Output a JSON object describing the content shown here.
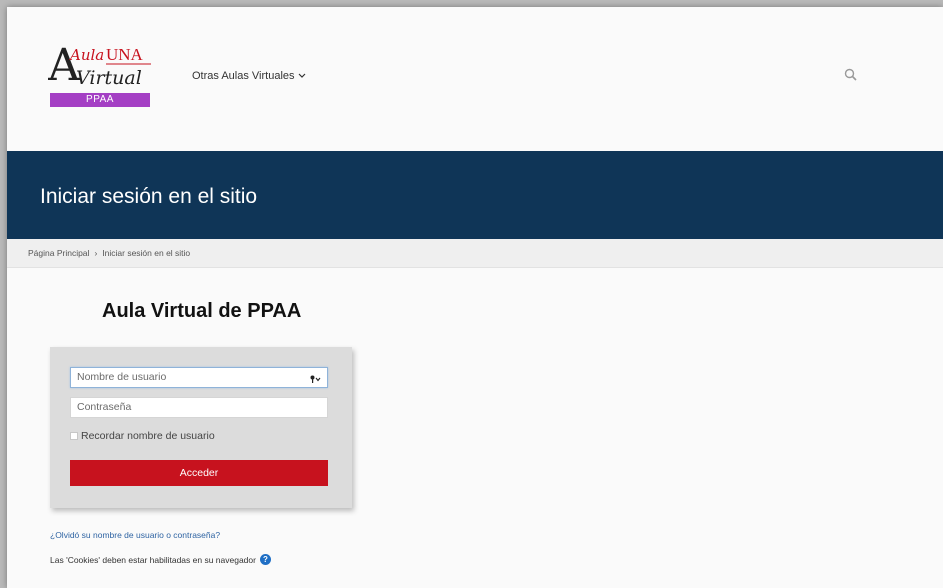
{
  "logo": {
    "word_aula": "Aula",
    "word_una": "UNA",
    "word_virtual": "Virtual",
    "badge": "PPAA"
  },
  "nav": {
    "menu_label": "Otras Aulas Virtuales",
    "search_icon": "search-icon",
    "chevron_icon": "chevron-down-icon"
  },
  "banner": {
    "title": "Iniciar sesión en el sitio"
  },
  "breadcrumb": {
    "items": [
      "Página Principal",
      "Iniciar sesión en el sitio"
    ],
    "separator": "›"
  },
  "login": {
    "site_title": "Aula Virtual de PPAA",
    "username_placeholder": "Nombre de usuario",
    "password_placeholder": "Contraseña",
    "remember_label": "Recordar nombre de usuario",
    "submit_label": "Acceder",
    "forgot_link": "¿Olvidó su nombre de usuario o contraseña?",
    "cookies_notice": "Las 'Cookies' deben estar habilitadas en su navegador"
  },
  "colors": {
    "banner_bg": "#0f3557",
    "submit_bg": "#c7121e",
    "badge_bg": "#a43fc4",
    "link": "#2f64a3",
    "logo_red": "#c7121e"
  }
}
